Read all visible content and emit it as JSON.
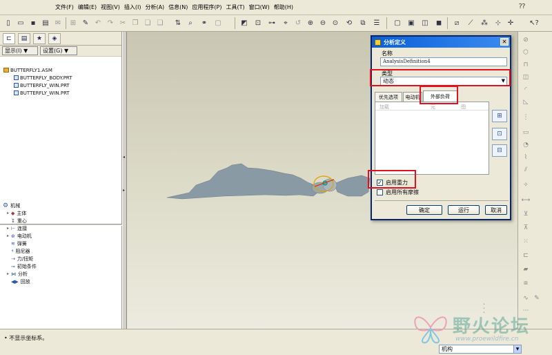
{
  "menu": {
    "items": [
      "文件(F)",
      "编辑(E)",
      "视图(V)",
      "插入(I)",
      "分析(A)",
      "信息(N)",
      "应用程序(P)",
      "工具(T)",
      "窗口(W)",
      "帮助(H)"
    ]
  },
  "left_panel": {
    "show_label": "显示(I) ▼",
    "settings_label": "设置(G) ▼",
    "model_tree": [
      {
        "label": "BUTTERFLY1.ASM"
      },
      {
        "label": "BUTTERFLY_BODY.PRT"
      },
      {
        "label": "BUTTERFLY_WIN.PRT"
      },
      {
        "label": "BUTTERFLY_WIN.PRT"
      }
    ],
    "mech_tree": [
      {
        "label": "机械"
      },
      {
        "label": "主体"
      },
      {
        "label": "重心"
      },
      {
        "label": "连接"
      },
      {
        "label": "电动机"
      },
      {
        "label": "弹簧"
      },
      {
        "label": "阻尼器"
      },
      {
        "label": "力/扭矩"
      },
      {
        "label": "初始条件"
      },
      {
        "label": "分析"
      },
      {
        "label": "回放"
      }
    ]
  },
  "dialog": {
    "title": "分析定义",
    "name_label": "名称",
    "name_value": "AnalysisDefinition4",
    "type_label": "类型",
    "type_value": "动态",
    "tabs": [
      "优先选项",
      "电动机",
      "外部负荷"
    ],
    "table_cols": [
      "加载",
      "元",
      "图"
    ],
    "gravity_label": "启用重力",
    "gravity_checked": true,
    "friction_label": "启用所有摩擦",
    "friction_checked": false,
    "ok_label": "确定",
    "run_label": "运行",
    "cancel_label": "取消"
  },
  "status": {
    "message": "• 不显示坐标系。",
    "selection_filter": "机构"
  },
  "watermark": {
    "title": "野火论坛",
    "url": "www.proewildfire.cn"
  },
  "colors": {
    "highlight_red": "#e01020",
    "dialog_title": "#0a5fd8",
    "model_gray": "#8a9aa4"
  }
}
